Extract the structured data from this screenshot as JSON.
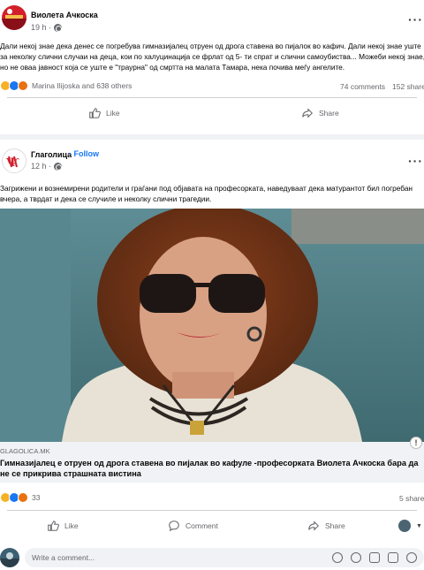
{
  "post1": {
    "author": "Виолета Ачкоска",
    "time": "19 h ·",
    "line1": "Дали некој знае дека денес се погребува гимназијалец  отруен од дрога ставена во пијалок во кафич. Дали некој знае уште",
    "line2": "за неколку слични случаи на деца, кои по халуцинација се фрлат од 5- ти спрат и слични самоубиства... Можеби некој знае,",
    "line3": "но не оваа јавност која се уште е \"траурна\" од смртта на малата Тамара, нека почива меѓу ангелите.",
    "reactors": "Marina Ilijoska and 638 others",
    "comments": "74 comments",
    "shares": "152 shares",
    "like_label": "Like",
    "share_label": "Share"
  },
  "post2": {
    "author": "Глаголица",
    "follow": "· Follow",
    "time": "12 h ·",
    "line1": "Загрижени и вознемирени родители и граѓани под објавата на професорката, наведуваат дека матурантот бил погребан",
    "line2": "вчера, а тврдат и дека се случиле и неколку слични трагедии.",
    "link_domain": "GLAGOLICA.MK",
    "link_title": "Гимназијалец е отруен од дрога ставена во пијалак во кафуле -професорката Виолета Ачкоска бара да не се прикрива страшната вистина",
    "reaction_count": "33",
    "shares": "5 shares",
    "like_label": "Like",
    "comment_label": "Comment",
    "share_label": "Share",
    "comment_placeholder": "Write a comment..."
  },
  "colors": {
    "accent": "#1877f2",
    "muted": "#65676b",
    "background": "#f0f2f5"
  },
  "icons": [
    "globe-icon",
    "more-options-icon",
    "like-icon",
    "share-icon",
    "comment-icon",
    "info-icon",
    "emoji-icon",
    "camera-icon",
    "gif-icon",
    "sticker-icon"
  ]
}
